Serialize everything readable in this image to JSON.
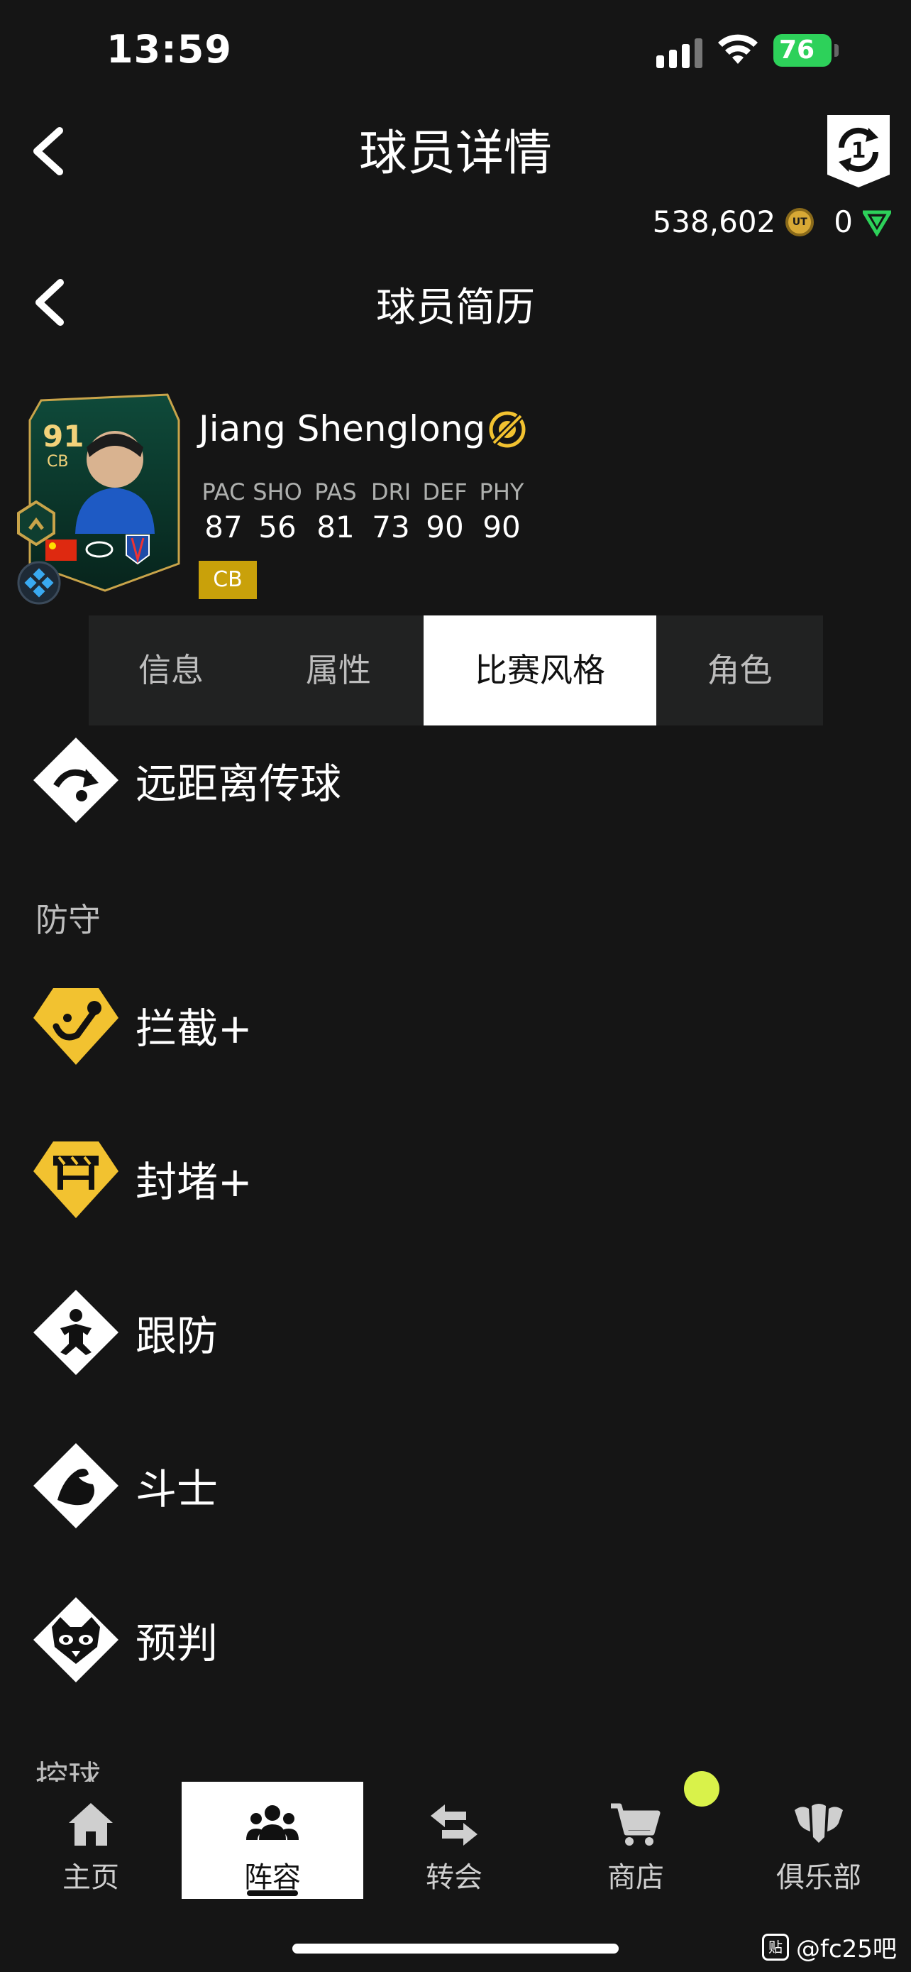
{
  "status_bar": {
    "time": "13:59",
    "battery": "76"
  },
  "header": {
    "title": "球员详情",
    "coins": "538,602",
    "points": "0"
  },
  "sub_header": {
    "title": "球员简历"
  },
  "player": {
    "name": "Jiang Shenglong",
    "rating": "91",
    "position": "CB",
    "stats": [
      {
        "label": "PAC",
        "value": "87"
      },
      {
        "label": "SHO",
        "value": "56"
      },
      {
        "label": "PAS",
        "value": "81"
      },
      {
        "label": "DRI",
        "value": "73"
      },
      {
        "label": "DEF",
        "value": "90"
      },
      {
        "label": "PHY",
        "value": "90"
      }
    ],
    "position_badge": "CB"
  },
  "tabs": [
    {
      "label": "信息",
      "active": false
    },
    {
      "label": "属性",
      "active": false
    },
    {
      "label": "比赛风格",
      "active": true
    },
    {
      "label": "角色",
      "active": false
    }
  ],
  "playstyles": {
    "passing": [
      {
        "label": "远距离传球",
        "icon": "long-pass-icon"
      }
    ],
    "defense_title": "防守",
    "defense": [
      {
        "label": "拦截+",
        "icon": "intercept-plus-icon"
      },
      {
        "label": "封堵+",
        "icon": "block-plus-icon"
      },
      {
        "label": "跟防",
        "icon": "jockey-icon"
      },
      {
        "label": "斗士",
        "icon": "bruiser-icon"
      },
      {
        "label": "预判",
        "icon": "anticipate-icon"
      }
    ],
    "ball_control_title": "控球"
  },
  "nav": [
    {
      "label": "主页",
      "icon": "home-icon"
    },
    {
      "label": "阵容",
      "icon": "squad-icon",
      "active": true
    },
    {
      "label": "转会",
      "icon": "transfer-icon"
    },
    {
      "label": "商店",
      "icon": "store-icon"
    },
    {
      "label": "俱乐部",
      "icon": "club-icon"
    }
  ],
  "watermark": "@fc25吧",
  "colors": {
    "gold": "#f2c230",
    "accent_green": "#2dd15a",
    "badge_gold": "#c9a10a",
    "notify": "#d9f24a"
  }
}
